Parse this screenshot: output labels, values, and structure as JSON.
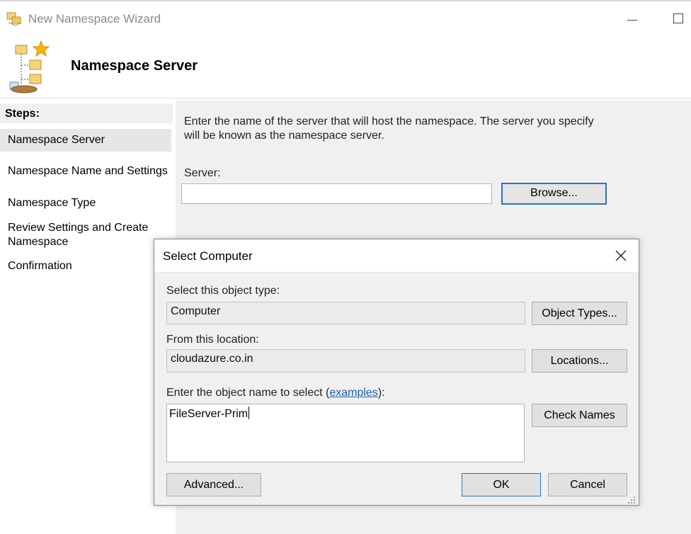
{
  "window": {
    "title": "New Namespace Wizard",
    "icon": "namespace-wizard-icon"
  },
  "header": {
    "title": "Namespace Server",
    "icon": "namespace-tree-icon"
  },
  "steps": {
    "label": "Steps:",
    "items": [
      {
        "label": "Namespace Server",
        "active": true
      },
      {
        "label": "Namespace Name and Settings",
        "active": false
      },
      {
        "label": "Namespace Type",
        "active": false
      },
      {
        "label": "Review Settings and Create Namespace",
        "active": false
      },
      {
        "label": "Confirmation",
        "active": false
      }
    ]
  },
  "content": {
    "instruction": "Enter the name of the server that will host the namespace. The server you specify will be known as the namespace server.",
    "server_label": "Server:",
    "server_value": "",
    "browse_label": "Browse..."
  },
  "dialog": {
    "title": "Select Computer",
    "object_type_label": "Select this object type:",
    "object_type_value": "Computer",
    "object_types_button": "Object Types...",
    "location_label": "From this location:",
    "location_value": "cloudazure.co.in",
    "locations_button": "Locations...",
    "enter_name_label_pre": "Enter the object name to select (",
    "enter_name_link": "examples",
    "enter_name_label_post": "):",
    "object_name_value": "FileServer-Prim",
    "check_names_button": "Check Names",
    "advanced_button": "Advanced...",
    "ok_button": "OK",
    "cancel_button": "Cancel"
  },
  "colors": {
    "accent": "#2a73c7",
    "link": "#1a5fb4",
    "panel": "#f0f0f0"
  }
}
